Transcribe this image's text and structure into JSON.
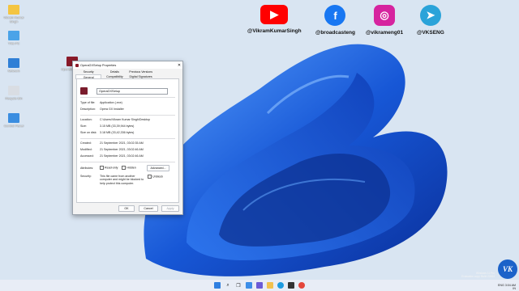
{
  "desktop_icons": [
    {
      "label": "Vikram Kumar Singh",
      "color": "#f4c542"
    },
    {
      "label": "This PC",
      "color": "#4aa3e8"
    },
    {
      "label": "Network",
      "color": "#2f7fd6"
    },
    {
      "label": "Recycle Bin",
      "color": "#d9dde3"
    },
    {
      "label": "Control Panel",
      "color": "#3a8de0"
    },
    {
      "label": "OperaGXSetup",
      "color": "#8a1a2a"
    }
  ],
  "social": [
    {
      "handle": "@VikramKumarSingh",
      "icon": "youtube-icon",
      "glyph": "▶",
      "color": "#ff0000"
    },
    {
      "handle": "@broadcasteng",
      "icon": "facebook-icon",
      "glyph": "f",
      "color": "#1877f2"
    },
    {
      "handle": "@vikrameng01",
      "icon": "instagram-icon",
      "glyph": "◎",
      "color": "#d6249f"
    },
    {
      "handle": "@VKSENG",
      "icon": "telegram-icon",
      "glyph": "➤",
      "color": "#2aa3d9"
    }
  ],
  "dialog": {
    "title": "OperaGXSetup Properties",
    "close": "✕",
    "tabs_row1": [
      "Security",
      "Details",
      "Previous Versions",
      ""
    ],
    "tabs_row2": [
      "General",
      "Compatibility",
      "Digital Signatures",
      ""
    ],
    "name": "OperaGXSetup",
    "rows": {
      "type_k": "Type of file:",
      "type_v": "Application (.exe)",
      "desc_k": "Description:",
      "desc_v": "Opera GX Installer",
      "loc_k": "Location:",
      "loc_v": "C:\\Users\\Vikram Kumar Singh\\Desktop",
      "size_k": "Size:",
      "size_v": "3.15 MB (33,39,944 bytes)",
      "sod_k": "Size on disk:",
      "sod_v": "3.18 MB (33,42,336 bytes)",
      "created_k": "Created:",
      "created_v": "21 September 2021, 03:02:35 AM",
      "modified_k": "Modified:",
      "modified_v": "21 September 2021, 03:02:46 AM",
      "accessed_k": "Accessed:",
      "accessed_v": "21 September 2021, 03:02:46 AM",
      "attr_k": "Attributes:",
      "readonly": "Read-only",
      "hidden": "Hidden",
      "advanced": "Advanced...",
      "sec_k": "Security:",
      "sec_v": "This file came from another computer and might be blocked to help protect this computer.",
      "unblock": "Unblock"
    },
    "buttons": {
      "ok": "OK",
      "cancel": "Cancel",
      "apply": "Apply"
    }
  },
  "taskbar": {
    "icons": [
      "windows-start-icon",
      "search-icon",
      "task-view-icon",
      "widgets-icon",
      "chat-icon",
      "file-explorer-icon",
      "edge-icon",
      "store-icon",
      "chrome-icon"
    ],
    "tray": {
      "lang": "ENG",
      "region": "IN",
      "time": "3:04 AM"
    }
  },
  "watermark": {
    "line1": "Windows 11 Pro",
    "line2": "Evaluation copy. Build 22454"
  }
}
